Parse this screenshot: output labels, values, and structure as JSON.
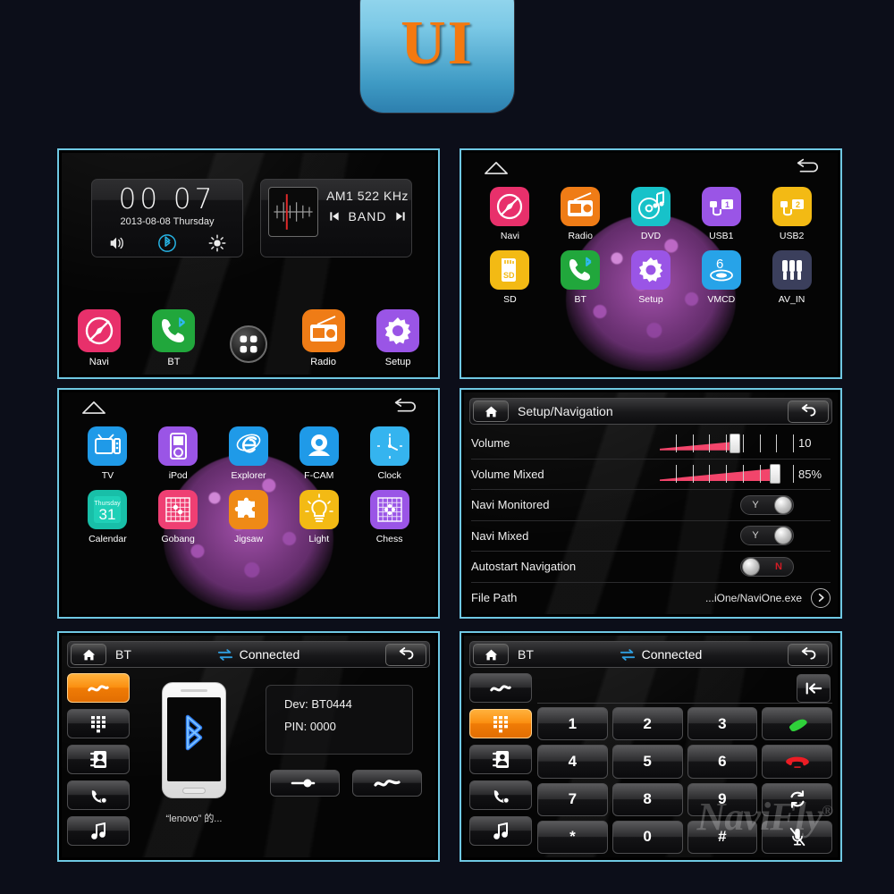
{
  "badge": {
    "label": "UI"
  },
  "theme": {
    "background": "#0c0e19",
    "panel_border": "#6fc8e3",
    "accent_orange": "#f08a0c",
    "slider_red": "#f2456b",
    "toggle_off_red": "#d31b25"
  },
  "panel1_home": {
    "clock": {
      "time": "00 07",
      "date": "2013-08-08  Thursday",
      "icons": [
        "volume-icon",
        "bluetooth-icon",
        "brightness-icon"
      ]
    },
    "radio": {
      "frequency": "AM1 522 KHz",
      "band_label": "BAND",
      "prev_icon": "prev-track-icon",
      "next_icon": "next-track-icon",
      "scale_icon": "tuner-scale-icon"
    },
    "dock": [
      {
        "label": "Navi",
        "icon": "compass-off-icon",
        "color": "#e8306b"
      },
      {
        "label": "BT",
        "icon": "phone-bluetooth-icon",
        "color": "#21a73c"
      },
      {
        "label": "",
        "icon": "apps-grid-icon",
        "color": ""
      },
      {
        "label": "Radio",
        "icon": "radio-icon",
        "color": "#ef7c16"
      },
      {
        "label": "Setup",
        "icon": "gear-icon",
        "color": "#9a55e6"
      }
    ]
  },
  "panel2_apps": {
    "home_icon": "home-outline-icon",
    "back_icon": "back-arrow-icon",
    "apps": [
      {
        "label": "Navi",
        "icon": "compass-off-icon",
        "color": "#e8306b"
      },
      {
        "label": "Radio",
        "icon": "radio-icon",
        "color": "#ef7c16"
      },
      {
        "label": "DVD",
        "icon": "disc-music-icon",
        "color": "#17c2c9"
      },
      {
        "label": "USB1",
        "icon": "usb-plug-1-icon",
        "color": "#9a55e6"
      },
      {
        "label": "USB2",
        "icon": "usb-plug-2-icon",
        "color": "#f3ba14"
      },
      {
        "label": "SD",
        "icon": "sd-card-icon",
        "color": "#f3ba14"
      },
      {
        "label": "BT",
        "icon": "phone-bluetooth-icon",
        "color": "#21a73c"
      },
      {
        "label": "Setup",
        "icon": "gear-icon",
        "color": "#9a55e6"
      },
      {
        "label": "VMCD",
        "icon": "vmcd-disc-6-icon",
        "color": "#27a3e8"
      },
      {
        "label": "AV_IN",
        "icon": "rca-plugs-icon",
        "color": "#3b3f5c"
      }
    ]
  },
  "panel3_apps2": {
    "home_icon": "home-outline-icon",
    "back_icon": "back-arrow-icon",
    "apps": [
      {
        "label": "TV",
        "icon": "television-icon",
        "color": "#1f9ae8"
      },
      {
        "label": "iPod",
        "icon": "ipod-icon",
        "color": "#9a55e6"
      },
      {
        "label": "Explorer",
        "icon": "explorer-e-icon",
        "color": "#1f9ae8"
      },
      {
        "label": "F-CAM",
        "icon": "webcam-icon",
        "color": "#1f9ae8"
      },
      {
        "label": "Clock",
        "icon": "clock-face-icon",
        "color": "#35b4ef"
      },
      {
        "label": "Calendar",
        "icon": "calendar-icon",
        "color": "#18bfa8",
        "day_name": "Thursday",
        "day_number": "31"
      },
      {
        "label": "Gobang",
        "icon": "gobang-board-icon",
        "color": "#ef3f73"
      },
      {
        "label": "Jigsaw",
        "icon": "puzzle-icon",
        "color": "#ef8a16"
      },
      {
        "label": "Light",
        "icon": "lightbulb-icon",
        "color": "#f3ba14"
      },
      {
        "label": "Chess",
        "icon": "chess-board-icon",
        "color": "#9a55e6"
      }
    ]
  },
  "panel4_setup": {
    "home_icon": "home-icon",
    "title": "Setup/Navigation",
    "back_icon": "back-arrow-icon",
    "rows": [
      {
        "name": "Volume",
        "type": "slider",
        "value": "10",
        "fill_percent": 55,
        "ticks": 8
      },
      {
        "name": "Volume Mixed",
        "type": "slider",
        "value": "85%",
        "fill_percent": 85,
        "ticks": 8
      },
      {
        "name": "Navi Monitored",
        "type": "toggle",
        "state": "on",
        "value": "Y"
      },
      {
        "name": "Navi Mixed",
        "type": "toggle",
        "state": "on",
        "value": "Y"
      },
      {
        "name": "Autostart Navigation",
        "type": "toggle",
        "state": "off",
        "value": "N"
      },
      {
        "name": "File Path",
        "type": "path",
        "value": "...iOne/NaviOne.exe",
        "arrow_icon": "chevron-right-icon"
      }
    ]
  },
  "panel5_bt": {
    "home_icon": "home-icon",
    "title": "BT",
    "status": "Connected",
    "status_icon": "two-way-arrows-icon",
    "back_icon": "back-arrow-icon",
    "sidebar": [
      {
        "icon": "bt-connect-icon",
        "active": true
      },
      {
        "icon": "dialpad-icon",
        "active": false
      },
      {
        "icon": "contacts-icon",
        "active": false
      },
      {
        "icon": "call-history-icon",
        "active": false
      },
      {
        "icon": "music-note-icon",
        "active": false
      }
    ],
    "phone_icon": "bluetooth-logo-icon",
    "phone_caption": "“lenovo” 的...",
    "info": {
      "device": "Dev: BT0444",
      "pin": "PIN: 0000"
    },
    "actions": [
      {
        "icon": "disconnect-icon"
      },
      {
        "icon": "bt-connect-icon"
      }
    ]
  },
  "panel6_dialpad": {
    "home_icon": "home-icon",
    "title": "BT",
    "status": "Connected",
    "status_icon": "two-way-arrows-icon",
    "back_icon": "back-arrow-icon",
    "sidebar": [
      {
        "icon": "bt-connect-icon",
        "active": false
      },
      {
        "icon": "dialpad-icon",
        "active": true
      },
      {
        "icon": "contacts-icon",
        "active": false
      },
      {
        "icon": "call-history-icon",
        "active": false
      },
      {
        "icon": "music-note-icon",
        "active": false
      }
    ],
    "number_input": "",
    "backspace_icon": "backspace-icon",
    "keys": [
      {
        "label": "1",
        "icon": ""
      },
      {
        "label": "2",
        "icon": ""
      },
      {
        "label": "3",
        "icon": ""
      },
      {
        "label": "",
        "icon": "call-answer-icon"
      },
      {
        "label": "4",
        "icon": ""
      },
      {
        "label": "5",
        "icon": ""
      },
      {
        "label": "6",
        "icon": ""
      },
      {
        "label": "",
        "icon": "call-end-icon"
      },
      {
        "label": "7",
        "icon": ""
      },
      {
        "label": "8",
        "icon": ""
      },
      {
        "label": "9",
        "icon": ""
      },
      {
        "label": "",
        "icon": "call-transfer-icon"
      },
      {
        "label": "*",
        "icon": ""
      },
      {
        "label": "0",
        "icon": ""
      },
      {
        "label": "#",
        "icon": ""
      },
      {
        "label": "",
        "icon": "mic-mute-icon"
      }
    ],
    "watermark": "NaviFly",
    "watermark_mark": "®"
  }
}
